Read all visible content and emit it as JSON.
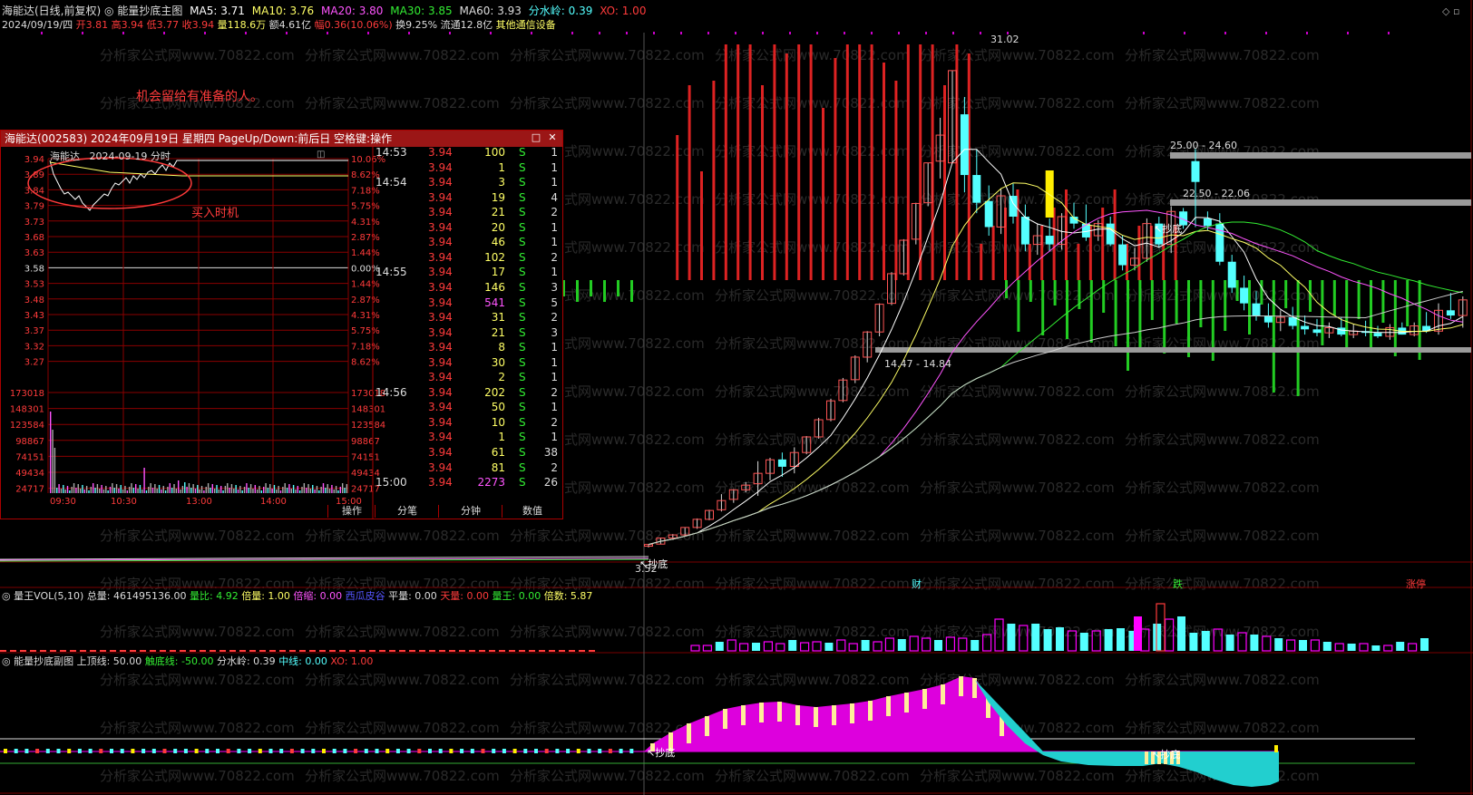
{
  "colors": {
    "up": "#ff3b3b",
    "down": "#54ffff",
    "vol_down": "#ff00ff",
    "ma5": "#ffffff",
    "ma10": "#ffff66",
    "ma20": "#ff55ff",
    "ma30": "#33ee33",
    "ma60": "#cccccc",
    "label": "#ff3333",
    "purple": "#cc00cc"
  },
  "header": {
    "title_seg1": "海能达(日线,前复权)",
    "title_seg2": "能量抄底主图",
    "ma5": "MA5: 3.71",
    "ma10": "MA10: 3.76",
    "ma20": "MA20: 3.80",
    "ma30": "MA30: 3.85",
    "ma60": "MA60: 3.93",
    "fsl": "分水岭: 0.39",
    "xo": "XO: 1.00"
  },
  "info_line": {
    "date": "2024/09/19/四",
    "open": "开3.81",
    "high": "高3.94",
    "low": "低3.77",
    "close": "收3.94",
    "vol": "量118.6万",
    "amount": "额4.61亿",
    "change": "幅0.36(10.06%)",
    "turnover": "换9.25%",
    "float": "流通12.8亿",
    "sector": "其他通信设备"
  },
  "annotation": "机会留给有准备的人。",
  "price_labels": {
    "high": "31.02",
    "box1": "25.00 - 24.60",
    "box2": "22.50 - 22.06",
    "box3": "14.47 - 14.84",
    "bottom_low": "3.52"
  },
  "signal_label": "抄底",
  "event_labels": {
    "fin": "财",
    "fall": "跌",
    "limit": "涨停"
  },
  "watermark": "分析家公式网www.70822.com",
  "vol_panel": {
    "name": "量王VOL(5,10)",
    "total": "总量: 461495136.00",
    "vr": "量比: 4.92",
    "bei": "倍量: 1.00",
    "suo": "倍缩: 0.00",
    "xi": "西瓜皮谷",
    "ping": "平量: 0.00",
    "tian": "天量: 0.00",
    "wang": "量王: 0.00",
    "beishu": "倍数: 5.87"
  },
  "osc_panel": {
    "name": "能量抄底副图",
    "up": "上顶线: 50.00",
    "bottom": "触底线: -50.00",
    "fsl": "分水岭: 0.39",
    "mid": "中线: 0.00",
    "xo": "XO: 1.00"
  },
  "intraday": {
    "title": "海能达(002583) 2024年09月19日 星期四 PageUp/Down:前后日 空格键:操作",
    "subtitle_name": "海能达",
    "subtitle_date": "2024-09-19 分时",
    "buy_label": "买入时机",
    "price_ticks": [
      "3.94",
      "3.89",
      "3.84",
      "3.79",
      "3.73",
      "3.68",
      "3.63",
      "3.58",
      "3.53",
      "3.48",
      "3.43",
      "3.37",
      "3.32",
      "3.27"
    ],
    "pct_ticks": [
      "10.06%",
      "8.62%",
      "7.18%",
      "5.75%",
      "4.31%",
      "2.87%",
      "1.44%",
      "0.00%",
      "1.44%",
      "2.87%",
      "4.31%",
      "5.75%",
      "7.18%",
      "8.62%"
    ],
    "vol_ticks": [
      "173018",
      "148301",
      "123584",
      "98867",
      "74151",
      "49434",
      "24717"
    ],
    "time_ticks": [
      "09:30",
      "10:30",
      "13:00",
      "14:00",
      "15:00"
    ],
    "ticks": [
      {
        "t": "14:53",
        "p": "3.94",
        "v": "100",
        "s": "S",
        "n": "1"
      },
      {
        "t": "",
        "p": "3.94",
        "v": "1",
        "s": "S",
        "n": "1"
      },
      {
        "t": "14:54",
        "p": "3.94",
        "v": "3",
        "s": "S",
        "n": "1"
      },
      {
        "t": "",
        "p": "3.94",
        "v": "19",
        "s": "S",
        "n": "4"
      },
      {
        "t": "",
        "p": "3.94",
        "v": "21",
        "s": "S",
        "n": "2"
      },
      {
        "t": "",
        "p": "3.94",
        "v": "20",
        "s": "S",
        "n": "1"
      },
      {
        "t": "",
        "p": "3.94",
        "v": "46",
        "s": "S",
        "n": "1"
      },
      {
        "t": "",
        "p": "3.94",
        "v": "102",
        "s": "S",
        "n": "2"
      },
      {
        "t": "14:55",
        "p": "3.94",
        "v": "17",
        "s": "S",
        "n": "1"
      },
      {
        "t": "",
        "p": "3.94",
        "v": "146",
        "s": "S",
        "n": "3"
      },
      {
        "t": "",
        "p": "3.94",
        "v": "541",
        "s": "S",
        "n": "5"
      },
      {
        "t": "",
        "p": "3.94",
        "v": "31",
        "s": "S",
        "n": "2"
      },
      {
        "t": "",
        "p": "3.94",
        "v": "21",
        "s": "S",
        "n": "3"
      },
      {
        "t": "",
        "p": "3.94",
        "v": "8",
        "s": "S",
        "n": "1"
      },
      {
        "t": "",
        "p": "3.94",
        "v": "30",
        "s": "S",
        "n": "1"
      },
      {
        "t": "",
        "p": "3.94",
        "v": "2",
        "s": "S",
        "n": "1"
      },
      {
        "t": "14:56",
        "p": "3.94",
        "v": "202",
        "s": "S",
        "n": "2"
      },
      {
        "t": "",
        "p": "3.94",
        "v": "50",
        "s": "S",
        "n": "1"
      },
      {
        "t": "",
        "p": "3.94",
        "v": "10",
        "s": "S",
        "n": "2"
      },
      {
        "t": "",
        "p": "3.94",
        "v": "1",
        "s": "S",
        "n": "1"
      },
      {
        "t": "",
        "p": "3.94",
        "v": "61",
        "s": "S",
        "n": "38"
      },
      {
        "t": "",
        "p": "3.94",
        "v": "81",
        "s": "S",
        "n": "2"
      },
      {
        "t": "15:00",
        "p": "3.94",
        "v": "2273",
        "s": "S",
        "n": "26"
      }
    ],
    "tabs": [
      "操作",
      "分笔",
      "分钟",
      "数值"
    ]
  },
  "chart_data": {
    "type": "candlestick",
    "ylim": [
      3.0,
      33.0
    ],
    "candles": [
      {
        "o": 3.6,
        "h": 3.72,
        "l": 3.52,
        "c": 3.7
      },
      {
        "o": 3.72,
        "h": 4.1,
        "l": 3.7,
        "c": 4.07
      },
      {
        "o": 4.07,
        "h": 4.3,
        "l": 4.0,
        "c": 4.25
      },
      {
        "o": 4.25,
        "h": 4.7,
        "l": 4.2,
        "c": 4.68
      },
      {
        "o": 4.68,
        "h": 5.2,
        "l": 4.6,
        "c": 5.15
      },
      {
        "o": 5.15,
        "h": 5.7,
        "l": 5.1,
        "c": 5.66
      },
      {
        "o": 5.7,
        "h": 6.6,
        "l": 5.6,
        "c": 6.23
      },
      {
        "o": 6.3,
        "h": 6.9,
        "l": 6.1,
        "c": 6.85
      },
      {
        "o": 6.85,
        "h": 7.3,
        "l": 6.7,
        "c": 7.12
      },
      {
        "o": 7.2,
        "h": 8.5,
        "l": 6.5,
        "c": 7.8
      },
      {
        "o": 7.8,
        "h": 8.7,
        "l": 7.4,
        "c": 8.58
      },
      {
        "o": 8.6,
        "h": 9.0,
        "l": 7.6,
        "c": 8.18
      },
      {
        "o": 8.2,
        "h": 9.3,
        "l": 7.8,
        "c": 9.0
      },
      {
        "o": 9.0,
        "h": 9.95,
        "l": 8.9,
        "c": 9.9
      },
      {
        "o": 9.9,
        "h": 11.0,
        "l": 9.8,
        "c": 10.89
      },
      {
        "o": 10.9,
        "h": 12.1,
        "l": 10.8,
        "c": 11.98
      },
      {
        "o": 12.0,
        "h": 13.3,
        "l": 11.9,
        "c": 13.18
      },
      {
        "o": 13.2,
        "h": 14.6,
        "l": 13.0,
        "c": 14.5
      },
      {
        "o": 14.5,
        "h": 16.0,
        "l": 14.2,
        "c": 15.95
      },
      {
        "o": 15.95,
        "h": 17.6,
        "l": 15.7,
        "c": 17.55
      },
      {
        "o": 17.6,
        "h": 19.4,
        "l": 17.5,
        "c": 19.31
      },
      {
        "o": 19.31,
        "h": 21.3,
        "l": 19.2,
        "c": 21.24
      },
      {
        "o": 21.3,
        "h": 23.4,
        "l": 21.0,
        "c": 23.36
      },
      {
        "o": 23.4,
        "h": 25.7,
        "l": 23.2,
        "c": 25.7
      },
      {
        "o": 25.8,
        "h": 28.3,
        "l": 24.8,
        "c": 27.3
      },
      {
        "o": 25.7,
        "h": 31.02,
        "l": 25.7,
        "c": 31.02
      },
      {
        "o": 28.5,
        "h": 29.5,
        "l": 24.0,
        "c": 25.0
      },
      {
        "o": 25.0,
        "h": 26.5,
        "l": 22.8,
        "c": 23.4
      },
      {
        "o": 23.5,
        "h": 24.4,
        "l": 21.5,
        "c": 22.0
      },
      {
        "o": 22.0,
        "h": 24.2,
        "l": 21.6,
        "c": 23.8
      },
      {
        "o": 23.8,
        "h": 24.5,
        "l": 22.2,
        "c": 22.6
      },
      {
        "o": 22.6,
        "h": 23.3,
        "l": 20.6,
        "c": 21.0
      },
      {
        "o": 21.0,
        "h": 22.2,
        "l": 20.4,
        "c": 21.5
      },
      {
        "o": 21.5,
        "h": 22.5,
        "l": 20.6,
        "c": 21.0
      },
      {
        "o": 21.0,
        "h": 22.8,
        "l": 20.7,
        "c": 22.6
      },
      {
        "o": 22.6,
        "h": 23.4,
        "l": 21.9,
        "c": 22.2
      },
      {
        "o": 22.2,
        "h": 23.3,
        "l": 21.2,
        "c": 21.4
      },
      {
        "o": 21.5,
        "h": 22.4,
        "l": 21.2,
        "c": 22.2
      },
      {
        "o": 22.2,
        "h": 22.6,
        "l": 20.9,
        "c": 21.0
      },
      {
        "o": 21.0,
        "h": 21.5,
        "l": 19.5,
        "c": 19.8
      },
      {
        "o": 19.8,
        "h": 20.8,
        "l": 19.5,
        "c": 20.2
      },
      {
        "o": 20.2,
        "h": 22.5,
        "l": 20.0,
        "c": 22.2
      },
      {
        "o": 22.2,
        "h": 22.6,
        "l": 20.8,
        "c": 21.0
      },
      {
        "o": 21.0,
        "h": 23.2,
        "l": 20.5,
        "c": 22.9
      },
      {
        "o": 22.9,
        "h": 23.1,
        "l": 21.9,
        "c": 22.1
      },
      {
        "o": 25.8,
        "h": 26.5,
        "l": 22.0,
        "c": 24.6
      },
      {
        "o": 22.5,
        "h": 22.9,
        "l": 21.8,
        "c": 22.06
      },
      {
        "o": 22.2,
        "h": 22.8,
        "l": 19.8,
        "c": 20.0
      },
      {
        "o": 20.0,
        "h": 20.4,
        "l": 18.2,
        "c": 18.5
      },
      {
        "o": 18.5,
        "h": 19.2,
        "l": 17.2,
        "c": 17.6
      },
      {
        "o": 17.6,
        "h": 18.3,
        "l": 16.6,
        "c": 16.9
      },
      {
        "o": 16.9,
        "h": 17.6,
        "l": 16.2,
        "c": 16.5
      },
      {
        "o": 16.5,
        "h": 17.2,
        "l": 16.0,
        "c": 16.8
      },
      {
        "o": 16.8,
        "h": 17.4,
        "l": 16.1,
        "c": 16.3
      },
      {
        "o": 16.3,
        "h": 16.9,
        "l": 15.8,
        "c": 16.1
      },
      {
        "o": 16.1,
        "h": 16.7,
        "l": 15.7,
        "c": 15.9
      },
      {
        "o": 15.9,
        "h": 16.5,
        "l": 15.6,
        "c": 16.2
      },
      {
        "o": 16.2,
        "h": 16.8,
        "l": 15.7,
        "c": 15.8
      },
      {
        "o": 15.8,
        "h": 16.4,
        "l": 15.6,
        "c": 16.0
      },
      {
        "o": 16.0,
        "h": 16.6,
        "l": 15.7,
        "c": 15.9
      },
      {
        "o": 15.9,
        "h": 16.3,
        "l": 15.6,
        "c": 15.7
      },
      {
        "o": 15.7,
        "h": 16.4,
        "l": 15.5,
        "c": 16.2
      },
      {
        "o": 16.2,
        "h": 16.5,
        "l": 15.8,
        "c": 15.8
      },
      {
        "o": 15.8,
        "h": 16.5,
        "l": 15.7,
        "c": 16.3
      },
      {
        "o": 16.3,
        "h": 17.1,
        "l": 15.9,
        "c": 16.0
      },
      {
        "o": 16.0,
        "h": 17.6,
        "l": 15.8,
        "c": 17.2
      },
      {
        "o": 17.2,
        "h": 18.2,
        "l": 16.7,
        "c": 16.9
      },
      {
        "o": 16.9,
        "h": 18.0,
        "l": 16.2,
        "c": 17.8
      }
    ],
    "ma_series": [
      "MA5",
      "MA10",
      "MA20",
      "MA30",
      "MA60"
    ]
  }
}
